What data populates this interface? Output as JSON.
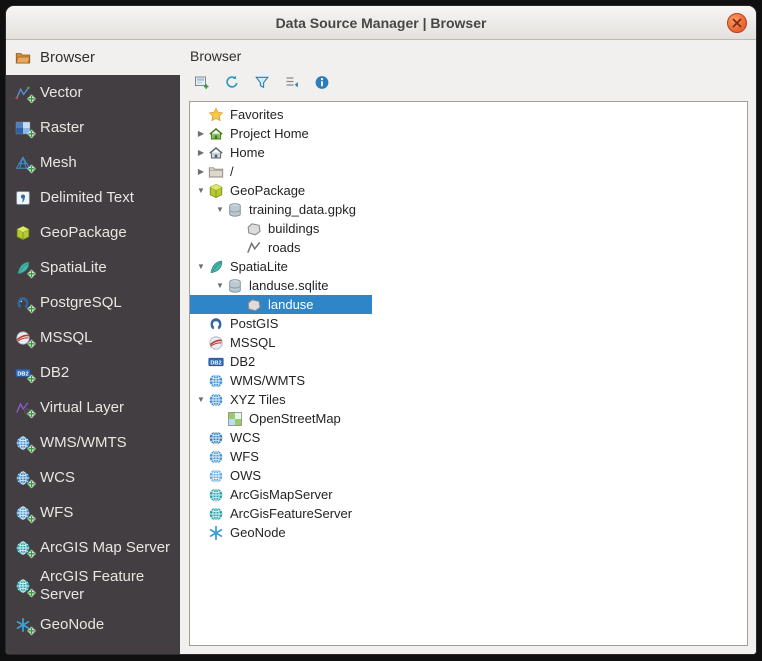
{
  "window": {
    "title": "Data Source Manager | Browser"
  },
  "colors": {
    "selection_blue": "#2e86c8",
    "close_button_orange": "#ef6c3a",
    "sidebar_background": "#423e41"
  },
  "sidebar": {
    "items": [
      {
        "label": "Browser",
        "icon": "browser-folder-icon",
        "selected": true
      },
      {
        "label": "Vector",
        "icon": "vector-icon",
        "selected": false
      },
      {
        "label": "Raster",
        "icon": "raster-icon",
        "selected": false
      },
      {
        "label": "Mesh",
        "icon": "mesh-icon",
        "selected": false
      },
      {
        "label": "Delimited Text",
        "icon": "delimited-text-icon",
        "selected": false
      },
      {
        "label": "GeoPackage",
        "icon": "geopackage-icon",
        "selected": false
      },
      {
        "label": "SpatiaLite",
        "icon": "spatialite-icon",
        "selected": false
      },
      {
        "label": "PostgreSQL",
        "icon": "postgresql-icon",
        "selected": false
      },
      {
        "label": "MSSQL",
        "icon": "mssql-icon",
        "selected": false
      },
      {
        "label": "DB2",
        "icon": "db2-icon",
        "selected": false
      },
      {
        "label": "Virtual Layer",
        "icon": "virtual-layer-icon",
        "selected": false
      },
      {
        "label": "WMS/WMTS",
        "icon": "wms-icon",
        "selected": false
      },
      {
        "label": "WCS",
        "icon": "wcs-icon",
        "selected": false
      },
      {
        "label": "WFS",
        "icon": "wfs-icon",
        "selected": false
      },
      {
        "label": "ArcGIS Map Server",
        "icon": "arcgis-map-server-icon",
        "selected": false
      },
      {
        "label": "ArcGIS Feature Server",
        "icon": "arcgis-feature-server-icon",
        "selected": false
      },
      {
        "label": "GeoNode",
        "icon": "geonode-icon",
        "selected": false
      }
    ]
  },
  "main": {
    "header": "Browser"
  },
  "toolbar": {
    "buttons": [
      {
        "name": "add-selected-layers-button",
        "icon": "add-layers-icon"
      },
      {
        "name": "refresh-button",
        "icon": "refresh-icon"
      },
      {
        "name": "filter-browser-button",
        "icon": "filter-icon"
      },
      {
        "name": "collapse-all-button",
        "icon": "collapse-icon"
      },
      {
        "name": "properties-widget-button",
        "icon": "info-icon"
      }
    ]
  },
  "tree": {
    "rows": [
      {
        "label": "Favorites",
        "icon": "favorites-star-icon",
        "level": 0,
        "expand": "none",
        "selected": false
      },
      {
        "label": "Project Home",
        "icon": "project-home-icon",
        "level": 0,
        "expand": "collapsed",
        "selected": false
      },
      {
        "label": "Home",
        "icon": "home-icon",
        "level": 0,
        "expand": "collapsed",
        "selected": false
      },
      {
        "label": "/",
        "icon": "folder-icon",
        "level": 0,
        "expand": "collapsed",
        "selected": false
      },
      {
        "label": "GeoPackage",
        "icon": "geopackage-icon",
        "level": 0,
        "expand": "expanded",
        "selected": false
      },
      {
        "label": "training_data.gpkg",
        "icon": "database-icon",
        "level": 1,
        "expand": "expanded",
        "selected": false
      },
      {
        "label": "buildings",
        "icon": "polygon-layer-icon",
        "level": 2,
        "expand": "none",
        "selected": false
      },
      {
        "label": "roads",
        "icon": "line-layer-icon",
        "level": 2,
        "expand": "none",
        "selected": false
      },
      {
        "label": "SpatiaLite",
        "icon": "spatialite-icon",
        "level": 0,
        "expand": "expanded",
        "selected": false
      },
      {
        "label": "landuse.sqlite",
        "icon": "database-icon",
        "level": 1,
        "expand": "expanded",
        "selected": false
      },
      {
        "label": "landuse",
        "icon": "polygon-layer-icon",
        "level": 2,
        "expand": "none",
        "selected": true
      },
      {
        "label": "PostGIS",
        "icon": "postgis-icon",
        "level": 0,
        "expand": "none",
        "selected": false
      },
      {
        "label": "MSSQL",
        "icon": "mssql-icon",
        "level": 0,
        "expand": "none",
        "selected": false
      },
      {
        "label": "DB2",
        "icon": "db2-icon",
        "level": 0,
        "expand": "none",
        "selected": false
      },
      {
        "label": "WMS/WMTS",
        "icon": "wms-icon",
        "level": 0,
        "expand": "none",
        "selected": false
      },
      {
        "label": "XYZ Tiles",
        "icon": "xyz-tiles-icon",
        "level": 0,
        "expand": "expanded",
        "selected": false
      },
      {
        "label": "OpenStreetMap",
        "icon": "osm-icon",
        "level": 1,
        "expand": "none",
        "selected": false
      },
      {
        "label": "WCS",
        "icon": "wcs-icon",
        "level": 0,
        "expand": "none",
        "selected": false
      },
      {
        "label": "WFS",
        "icon": "wfs-icon",
        "level": 0,
        "expand": "none",
        "selected": false
      },
      {
        "label": "OWS",
        "icon": "ows-icon",
        "level": 0,
        "expand": "none",
        "selected": false
      },
      {
        "label": "ArcGisMapServer",
        "icon": "arcgis-map-server-icon",
        "level": 0,
        "expand": "none",
        "selected": false
      },
      {
        "label": "ArcGisFeatureServer",
        "icon": "arcgis-feature-server-icon",
        "level": 0,
        "expand": "none",
        "selected": false
      },
      {
        "label": "GeoNode",
        "icon": "geonode-icon",
        "level": 0,
        "expand": "none",
        "selected": false
      }
    ]
  }
}
